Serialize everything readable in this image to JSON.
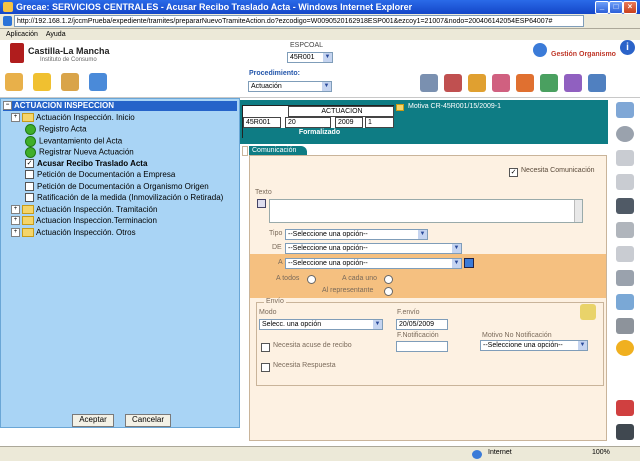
{
  "window": {
    "title": "Grecae: SERVICIOS CENTRALES - Acusar Recibo Traslado Acta - Windows Internet Explorer",
    "address": "http://192.168.1.2/jccmPrueba/expediente/tramites/prepararNuevoTramiteAction.do?ezcodigo=W0090520162918ESP001&ezcoy1=21007&nodo=200406142054ESP64007#"
  },
  "menu": [
    "Aplicación",
    "Ayuda"
  ],
  "header": {
    "org_name": "Castilla-La Mancha",
    "org_sub": "Instituto de Consumo",
    "espcoal_label": "ESPCOAL",
    "espcoal_value": "45R001",
    "gestion_label": "Gestión Organismo",
    "procedimiento_label": "Procedimiento:",
    "procedimiento_value": "Actuación"
  },
  "tree": {
    "root": "ACTUACION INSPECCION",
    "items": [
      {
        "label": "Actuación Inspección. Inicio",
        "level": 1,
        "kind": "folder"
      },
      {
        "label": "Registro Acta",
        "level": 2,
        "kind": "done"
      },
      {
        "label": "Levantamiento del Acta",
        "level": 2,
        "kind": "done"
      },
      {
        "label": "Registrar Nueva Actuación",
        "level": 2,
        "kind": "done"
      },
      {
        "label": "Acusar Recibo Traslado Acta",
        "level": 2,
        "kind": "checked"
      },
      {
        "label": "Petición de Documentación a Empresa",
        "level": 2,
        "kind": "unchecked"
      },
      {
        "label": "Petición de Documentación a Organismo Origen",
        "level": 2,
        "kind": "unchecked"
      },
      {
        "label": "Ratificación de la medida (Inmovilización o Retirada)",
        "level": 2,
        "kind": "unchecked"
      },
      {
        "label": "Actuación Inspección. Tramitación",
        "level": 1,
        "kind": "folder"
      },
      {
        "label": "Actuacion Inspeccion.Terminacion",
        "level": 1,
        "kind": "folder"
      },
      {
        "label": "Actuación Inspección. Otros",
        "level": 1,
        "kind": "folder"
      }
    ],
    "accept": "Aceptar",
    "cancel": "Cancelar"
  },
  "case": {
    "heading": "ACTUACION",
    "code": "45R001",
    "num": "20",
    "year": "2009",
    "seq": "1",
    "status": "Formalizado",
    "motiva": "Motiva CR-45R001/15/2009-1"
  },
  "comm": {
    "tab": "Comunicación",
    "needs_comm": "Necesita Comunicación",
    "texto": "Texto",
    "tipo_label": "Tipo",
    "tipo_value": "--Seleccione una opción--",
    "de_label": "DE",
    "de_value": "--Seleccione una opción--",
    "a_label": "A",
    "a_value": "--Seleccione una opción--",
    "a_todos": "A todos",
    "a_cada_uno": "A cada uno",
    "al_representante": "Al representante",
    "envio": "Envío",
    "modo_label": "Modo",
    "modo_value": "Selecc. una opción",
    "fenvio_label": "F.envío",
    "fenvio_value": "20/05/2009",
    "fnotif_label": "F.Notificación",
    "acuse": "Necesita acuse de recibo",
    "motivo_label": "Motivo No Notificación",
    "motivo_value": "--Seleccione una opción--",
    "respuesta": "Necesita Respuesta"
  },
  "status": {
    "zone": "Internet",
    "zoom": "100%"
  }
}
